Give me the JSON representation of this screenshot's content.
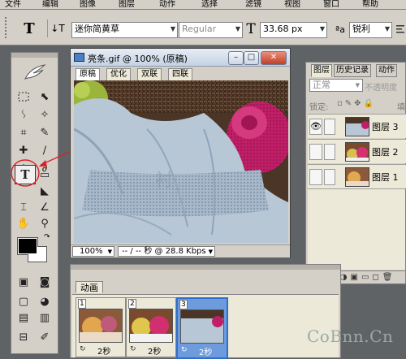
{
  "menubar": {
    "items": [
      "文件",
      "编辑",
      "图像",
      "图层",
      "动作",
      "选择",
      "滤镜",
      "视图",
      "窗口",
      "帮助"
    ]
  },
  "options_bar": {
    "tool_glyph": "T",
    "orient_glyph": "↓T",
    "font_family": "迷你简黄草",
    "font_style": "Regular",
    "size_glyph": "T",
    "font_size": "33.68 px",
    "aa_glyph": "ªa",
    "antialias": "锐利"
  },
  "document": {
    "title": "亮条.gif @ 100% (原稿)",
    "tabs": [
      "原稿",
      "优化",
      "双联",
      "四联"
    ],
    "active_tab": 0,
    "zoom": "100%",
    "status": "-- / -- 秒 @ 28.8 Kbps"
  },
  "layers_panel": {
    "tabs": [
      "图层",
      "历史记录",
      "动作"
    ],
    "blend_mode": "正常",
    "opacity_label": "不透明度",
    "lock_label": "锁定:",
    "fill_label": "填",
    "layers": [
      {
        "name": "图层 3",
        "visible": true
      },
      {
        "name": "图层 2",
        "visible": false
      },
      {
        "name": "图层 1",
        "visible": false
      }
    ]
  },
  "animation_panel": {
    "tab": "动画",
    "frames": [
      {
        "number": "1",
        "delay": "2秒",
        "selected": false
      },
      {
        "number": "2",
        "delay": "2秒",
        "selected": false
      },
      {
        "number": "3",
        "delay": "2秒",
        "selected": true
      }
    ]
  },
  "watermark": "CoBnn.Cn",
  "colors": {
    "ui_gray": "#d4d0c8",
    "workspace": "#5f6366",
    "selection_blue": "#2f6fd0",
    "annotation_red": "#d8232a"
  }
}
